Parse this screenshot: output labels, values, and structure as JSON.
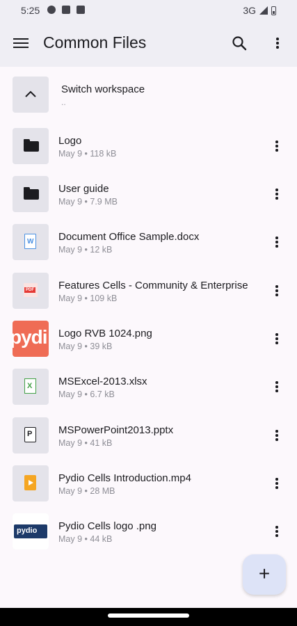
{
  "status_bar": {
    "time": "5:25",
    "network": "3G"
  },
  "app_bar": {
    "title": "Common Files"
  },
  "workspace": {
    "label": "Switch workspace",
    "sub": ".."
  },
  "thumbnails": {
    "pydio_logo_text": "pydi",
    "pydio_small_text": "pydio"
  },
  "files": [
    {
      "name": "Logo",
      "meta": "May 9 • 118 kB",
      "icon": "folder-icon"
    },
    {
      "name": "User guide",
      "meta": "May 9 • 7.9 MB",
      "icon": "folder-icon"
    },
    {
      "name": "Document Office Sample.docx",
      "meta": "May 9 • 12 kB",
      "icon": "word-file-icon"
    },
    {
      "name": "Features Cells - Community & Enterprise",
      "meta": "May 9 • 109 kB",
      "icon": "pdf-file-icon"
    },
    {
      "name": "Logo RVB 1024.png",
      "meta": "May 9 • 39 kB",
      "icon": "image-thumbnail"
    },
    {
      "name": "MSExcel-2013.xlsx",
      "meta": "May 9 • 6.7 kB",
      "icon": "excel-file-icon"
    },
    {
      "name": "MSPowerPoint2013.pptx",
      "meta": "May 9 • 41 kB",
      "icon": "powerpoint-file-icon"
    },
    {
      "name": "Pydio Cells Introduction.mp4",
      "meta": "May 9 • 28 MB",
      "icon": "video-file-icon"
    },
    {
      "name": "Pydio Cells logo .png",
      "meta": "May 9 • 44 kB",
      "icon": "image-thumbnail"
    }
  ],
  "fab": {
    "label": "+"
  }
}
